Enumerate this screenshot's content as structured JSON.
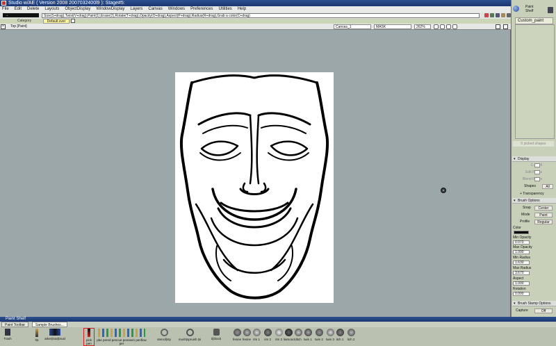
{
  "window": {
    "title": "Studio w/AE ( Version 2008  2007032400l9 ): Stage#5:"
  },
  "menu": [
    "File",
    "Edit",
    "Delete",
    "Layouts",
    "ObjectDisplay",
    "WindowDisplay",
    "Layers",
    "Canvas",
    "Windows",
    "Preferences",
    "Utilities",
    "Help"
  ],
  "toolbar": {
    "mode_label": "→",
    "command_line": "Size(S+drag),Twist(V+drag),Paint(1),Erase(2),Rotate(T+drag),Opacity(O+drag),Aspect(P+drag),Radius(R+drag),Grab a color(C+drag)"
  },
  "shelf_tabs": {
    "category": "Category",
    "default": "Default.sver"
  },
  "viewport": {
    "title": "Top [Paint]",
    "canvas_field": "Canvas_1",
    "mask_field": "MASK",
    "zoom": "262%"
  },
  "right_panel": {
    "shelf_title_1": "Paint",
    "shelf_title_2": "Shelf",
    "custom_tab": "Custom_paint",
    "picked_label": "0 picked shapes",
    "display": {
      "header": "Display",
      "items": [
        "C-Shell",
        "Edit Points",
        "Blend Points"
      ],
      "shapes_label": "Shapes",
      "shapes_value": "All",
      "transparency": "Transparency"
    },
    "brush": {
      "header": "Brush Options",
      "snap_label": "Snap",
      "snap_value": "Center",
      "mode_label": "Mode",
      "mode_value": "Paint",
      "profile_label": "Profile",
      "profile_value": "Regular",
      "color_label": "Color",
      "min_opacity_label": "Min Opacity",
      "min_opacity": "0.070",
      "max_opacity_label": "Max Opacity",
      "max_opacity": "1.000",
      "min_radius_label": "Min Radius",
      "min_radius": "1.630",
      "max_radius_label": "Max Radius",
      "max_radius": "3.670",
      "aspect_label": "Aspect",
      "aspect": "1.000",
      "rotation_label": "Rotation",
      "rotation": "0.000"
    },
    "stamp": {
      "header": "Brush Stamp Options",
      "capture_label": "Capture",
      "capture_value": "Off"
    }
  },
  "bottom_shelf": {
    "title": "Paint Shelf",
    "tabs": [
      "Paint Toolbar",
      "Sample Brushes..."
    ],
    "tools": [
      {
        "label": "Trash"
      },
      {
        "label": "hb"
      },
      {
        "label": "arker|inar|brusl"
      },
      {
        "label": "pick pen"
      },
      {
        "label": "pbe pered pencue penseen penflow per"
      },
      {
        "label": "stencil|sty"
      },
      {
        "label": "mush|spruish |si"
      },
      {
        "label": "ti|block"
      },
      {
        "label": "fesine"
      },
      {
        "label": "fesine"
      },
      {
        "label": "rim 1"
      },
      {
        "label": "rim 2"
      },
      {
        "label": "rim 3"
      },
      {
        "label": "liamond"
      },
      {
        "label": "ditch"
      },
      {
        "label": "twin 1"
      },
      {
        "label": "twin 2"
      },
      {
        "label": "twin 3"
      },
      {
        "label": "itch 1"
      },
      {
        "label": "itch 2"
      }
    ]
  },
  "colors": {
    "title_bar": "#1a3772",
    "viewport_bg": "#9ba7a9",
    "shelf_tab_default": "#fff8a0",
    "highlight_tool": "#d42020"
  }
}
